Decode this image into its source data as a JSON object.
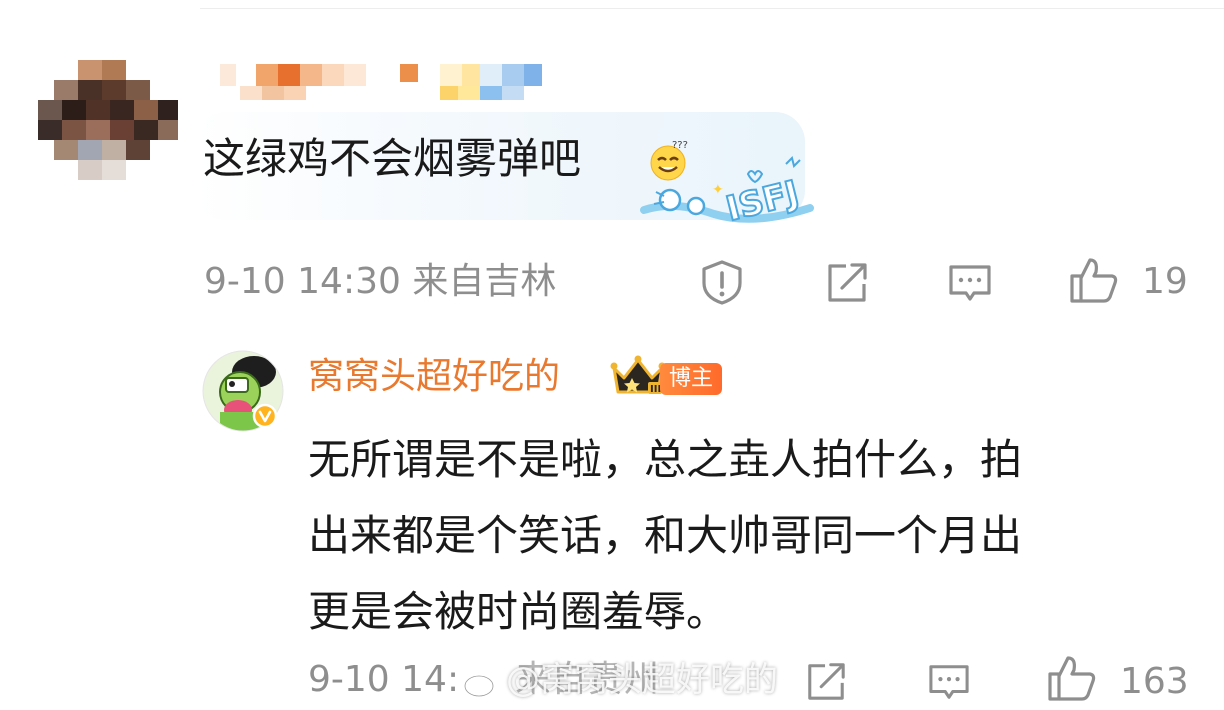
{
  "comment": {
    "text": "这绿鸡不会烟雾弹吧",
    "emoji_icon": "dizzy-smile-emoji-icon",
    "sticker_label": "ISFJ",
    "meta": "9-10 14:30 来自吉林",
    "likes": "19"
  },
  "reply": {
    "username": "窝窝头超好吃的",
    "badge": "博主",
    "lines": [
      "无所谓是不是啦，总之垚人拍什么，拍",
      "出来都是个笑话，和大帅哥同一个月出",
      "更是会被时尚圈羞辱。"
    ],
    "meta": "9-10 14:",
    "meta_obscured": "来自贵州",
    "likes": "163"
  },
  "watermark": "@窝窝头超好吃的",
  "icons": {
    "report": "report-icon",
    "repost": "repost-icon",
    "reply": "comment-icon",
    "like": "thumbs-up-icon"
  },
  "colors": {
    "username": "#e8792f",
    "badge": "#ff7a33",
    "meta_gray": "#8e8e8e"
  }
}
